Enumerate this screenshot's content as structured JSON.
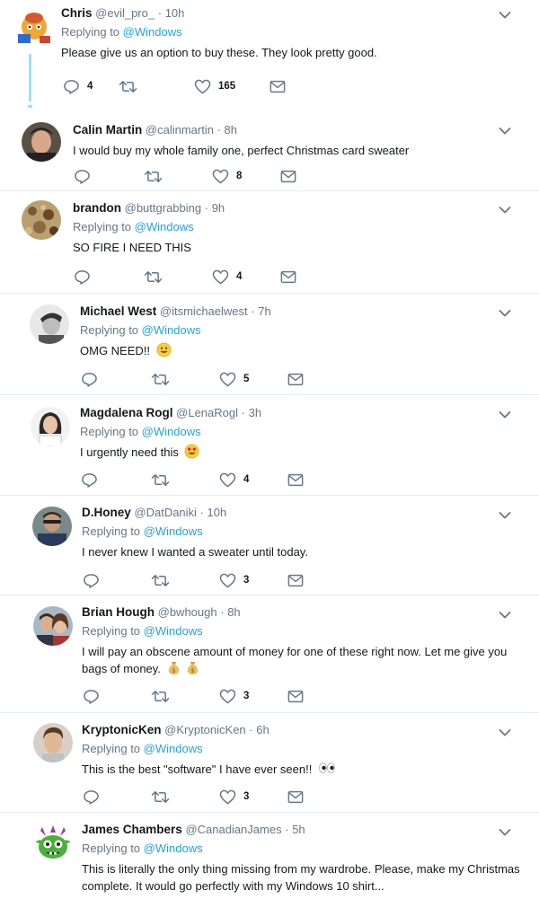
{
  "reply_prefix": "Replying to",
  "dot": "·",
  "tweets": [
    {
      "name": "Chris",
      "handle": "@evil_pro_",
      "time": "10h",
      "mention": "@Windows",
      "text": "Please give us an option to buy these. They look pretty good.",
      "replies": "4",
      "retweets": "",
      "likes": "165"
    },
    {
      "name": "Calin Martin",
      "handle": "@calinmartin",
      "time": "8h",
      "mention": "",
      "text": "I would buy my whole family one, perfect Christmas card sweater",
      "replies": "",
      "retweets": "",
      "likes": "8"
    },
    {
      "name": "brandon",
      "handle": "@buttgrabbing",
      "time": "9h",
      "mention": "@Windows",
      "text": "SO FIRE I NEED THIS",
      "replies": "",
      "retweets": "",
      "likes": "4"
    },
    {
      "name": "Michael West",
      "handle": "@itsmichaelwest",
      "time": "7h",
      "mention": "@Windows",
      "text": "OMG NEED!!",
      "replies": "",
      "retweets": "",
      "likes": "5"
    },
    {
      "name": "Magdalena Rogl",
      "handle": "@LenaRogl",
      "time": "3h",
      "mention": "@Windows",
      "text": "I urgently need this",
      "replies": "",
      "retweets": "",
      "likes": "4"
    },
    {
      "name": "D.Honey",
      "handle": "@DatDaniki",
      "time": "10h",
      "mention": "@Windows",
      "text": "I never knew I wanted a sweater until today.",
      "replies": "",
      "retweets": "",
      "likes": "3"
    },
    {
      "name": "Brian Hough",
      "handle": "@bwhough",
      "time": "8h",
      "mention": "@Windows",
      "text": "I will pay an obscene amount of money for one of these right now. Let me give you bags of money.",
      "replies": "",
      "retweets": "",
      "likes": "3"
    },
    {
      "name": "KryptonicKen",
      "handle": "@KryptonicKen",
      "time": "6h",
      "mention": "@Windows",
      "text": "This is the best \"software\" I have ever seen!!",
      "replies": "",
      "retweets": "",
      "likes": "3"
    },
    {
      "name": "James Chambers",
      "handle": "@CanadianJames",
      "time": "5h",
      "mention": "@Windows",
      "text": "This is literally the only thing missing from my wardrobe. Please, make my Christmas complete. It would go perfectly with my Windows 10 shirt...",
      "replies": "",
      "retweets": "",
      "likes": ""
    }
  ],
  "colors": {
    "accent": "#1da1f2",
    "muted": "#657786",
    "thread": "#9edff7",
    "divider": "#e6ecf0"
  },
  "icons": [
    "reply-icon",
    "retweet-icon",
    "heart-icon",
    "dm-icon",
    "chevron-down-icon",
    "smiley-emoji",
    "heart-eyes-emoji",
    "money-bag-emoji",
    "eyes-emoji"
  ]
}
